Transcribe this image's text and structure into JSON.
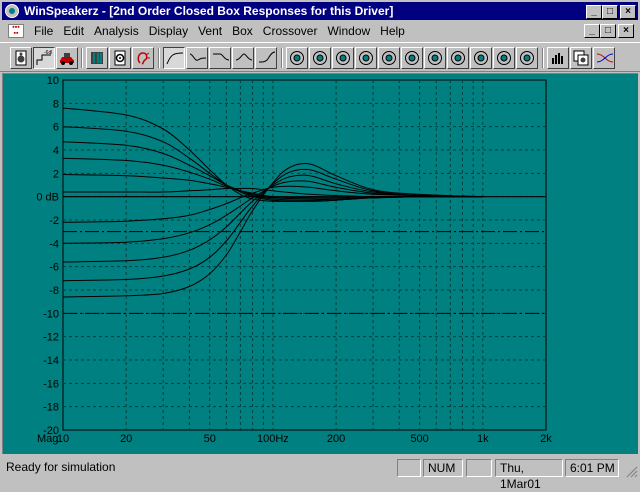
{
  "window": {
    "title": "WinSpeakerz - [2nd Order Closed Box Responses for this Driver]",
    "minimize": "_",
    "maximize": "□",
    "close": "×"
  },
  "menu": {
    "items": [
      "File",
      "Edit",
      "Analysis",
      "Display",
      "Vent",
      "Box",
      "Crossover",
      "Window",
      "Help"
    ]
  },
  "toolbar": {
    "groups": [
      [
        "speaker-driver-icon",
        "6db-slope-icon",
        "car-icon"
      ],
      [
        "cabinet-icon",
        "enclosure-icon",
        "ear-icon"
      ],
      [
        "highpass-response-icon",
        "bandpass-response-icon",
        "lowpass-response-icon",
        "peak-response-icon",
        "notch-response-icon"
      ],
      [
        "meter-icon",
        "meter-1-icon",
        "meter-2-icon",
        "meter-3-icon",
        "meter-4-icon",
        "meter-5-icon",
        "meter-6-icon",
        "meter-7-icon",
        "meter-8-icon",
        "meter-9-icon",
        "meter-10-icon"
      ],
      [
        "bar-graph-icon",
        "copy-window-icon",
        "crossover-icon"
      ]
    ]
  },
  "status": {
    "message": "Ready for simulation",
    "num": "NUM",
    "date": "Thu, 1Mar01",
    "time": "6:01 PM"
  },
  "chart_data": {
    "type": "line",
    "x_scale": "log",
    "xlim": [
      10,
      2000
    ],
    "ylim": [
      -20,
      10
    ],
    "y_ticks": [
      10,
      8,
      6,
      4,
      2,
      0,
      -2,
      -4,
      -6,
      -8,
      -10,
      -12,
      -14,
      -16,
      -18,
      -20
    ],
    "y_tick_labels": [
      "10",
      "8",
      "6",
      "4",
      "2",
      "0 dB",
      "-2",
      "-4",
      "-6",
      "-8",
      "-10",
      "-12",
      "-14",
      "-16",
      "-18",
      "-20"
    ],
    "y_axis_label": "Mag",
    "x_ticks": [
      10,
      20,
      50,
      100,
      200,
      500,
      1000,
      2000
    ],
    "x_tick_labels": [
      "10",
      "20",
      "50",
      "100Hz",
      "200",
      "500",
      "1k",
      "2k"
    ],
    "grid": true,
    "reference_lines_db": [
      -3,
      -10
    ],
    "series": [
      {
        "x": [
          10,
          20,
          30,
          40,
          50,
          60,
          70,
          80,
          100,
          150,
          200,
          300,
          500,
          1000
        ],
        "y": [
          7.6,
          7.0,
          5.8,
          4.0,
          2.3,
          1.0,
          0.2,
          -0.2,
          -0.4,
          -0.4,
          -0.3,
          -0.1,
          0.0,
          0.0
        ]
      },
      {
        "x": [
          10,
          20,
          30,
          40,
          50,
          60,
          70,
          80,
          100,
          150,
          200,
          300,
          500,
          1000
        ],
        "y": [
          6.0,
          5.6,
          4.7,
          3.3,
          2.0,
          1.0,
          0.4,
          0.0,
          -0.3,
          -0.4,
          -0.3,
          -0.1,
          0.0,
          0.0
        ]
      },
      {
        "x": [
          10,
          20,
          30,
          40,
          50,
          60,
          70,
          80,
          100,
          150,
          200,
          300,
          500,
          1000
        ],
        "y": [
          4.7,
          4.4,
          3.7,
          2.7,
          1.8,
          1.0,
          0.5,
          0.1,
          -0.2,
          -0.3,
          -0.2,
          -0.1,
          0.0,
          0.0
        ]
      },
      {
        "x": [
          10,
          20,
          30,
          40,
          50,
          60,
          70,
          80,
          100,
          150,
          200,
          300,
          500,
          1000
        ],
        "y": [
          3.3,
          3.1,
          2.7,
          2.1,
          1.5,
          0.9,
          0.5,
          0.2,
          -0.1,
          -0.2,
          -0.2,
          -0.1,
          0.0,
          0.0
        ]
      },
      {
        "x": [
          10,
          20,
          30,
          40,
          50,
          60,
          70,
          80,
          100,
          150,
          200,
          300,
          500,
          1000
        ],
        "y": [
          1.9,
          1.8,
          1.6,
          1.4,
          1.1,
          0.8,
          0.5,
          0.3,
          0.0,
          -0.1,
          -0.1,
          0.0,
          0.0,
          0.0
        ]
      },
      {
        "x": [
          10,
          20,
          30,
          40,
          50,
          60,
          70,
          80,
          100,
          150,
          200,
          300,
          500,
          1000
        ],
        "y": [
          0.4,
          0.4,
          0.4,
          0.5,
          0.6,
          0.7,
          0.7,
          0.7,
          0.5,
          0.2,
          0.1,
          0.0,
          0.0,
          0.0
        ]
      },
      {
        "x": [
          10,
          20,
          30,
          40,
          50,
          60,
          70,
          80,
          100,
          120,
          150,
          200,
          300,
          500,
          1000
        ],
        "y": [
          -2.2,
          -2.1,
          -1.9,
          -1.6,
          -1.1,
          -0.6,
          -0.1,
          0.3,
          0.8,
          0.9,
          0.8,
          0.5,
          0.2,
          0.1,
          0.0
        ]
      },
      {
        "x": [
          10,
          20,
          30,
          40,
          50,
          60,
          70,
          80,
          100,
          120,
          150,
          200,
          300,
          500,
          1000
        ],
        "y": [
          -4.0,
          -3.9,
          -3.6,
          -3.1,
          -2.4,
          -1.6,
          -0.8,
          -0.1,
          0.9,
          1.3,
          1.3,
          0.8,
          0.3,
          0.1,
          0.0
        ]
      },
      {
        "x": [
          10,
          20,
          30,
          40,
          50,
          60,
          70,
          80,
          100,
          120,
          150,
          200,
          300,
          500,
          1000
        ],
        "y": [
          -5.6,
          -5.5,
          -5.2,
          -4.6,
          -3.7,
          -2.6,
          -1.4,
          -0.4,
          1.0,
          1.7,
          1.8,
          1.1,
          0.4,
          0.1,
          0.0
        ]
      },
      {
        "x": [
          10,
          20,
          30,
          40,
          50,
          60,
          70,
          80,
          100,
          120,
          150,
          200,
          300,
          500,
          1000
        ],
        "y": [
          -7.2,
          -7.1,
          -6.8,
          -6.2,
          -5.2,
          -3.8,
          -2.2,
          -0.8,
          1.1,
          2.1,
          2.3,
          1.5,
          0.5,
          0.1,
          0.0
        ]
      },
      {
        "x": [
          10,
          20,
          30,
          40,
          50,
          60,
          70,
          80,
          100,
          120,
          150,
          200,
          300,
          500,
          1000
        ],
        "y": [
          -8.6,
          -8.5,
          -8.3,
          -7.7,
          -6.6,
          -5.0,
          -3.0,
          -1.2,
          1.2,
          2.5,
          2.8,
          1.8,
          0.6,
          0.2,
          0.0
        ]
      }
    ]
  }
}
